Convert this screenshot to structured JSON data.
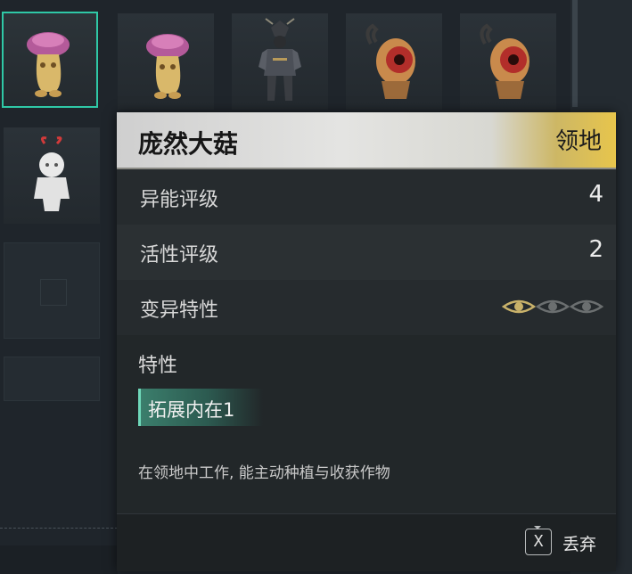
{
  "tooltip": {
    "title": "庞然大菇",
    "tag": "领地",
    "stats": [
      {
        "label": "异能评级",
        "value": "4"
      },
      {
        "label": "活性评级",
        "value": "2"
      }
    ],
    "mutation": {
      "label": "变异特性",
      "level": 1,
      "max": 3
    },
    "traits_heading": "特性",
    "trait_chip": "拓展内在1",
    "description": "在领地中工作, 能主动种植与收获作物",
    "discard": {
      "key": "X",
      "label": "丢弃"
    }
  },
  "inventory": [
    {
      "icon": "mushroom-creature-icon",
      "selected": true
    },
    {
      "icon": "mushroom-creature-icon",
      "selected": false
    },
    {
      "icon": "samurai-armor-icon",
      "selected": false
    },
    {
      "icon": "red-eye-creature-icon",
      "selected": false
    },
    {
      "icon": "red-eye-creature-icon",
      "selected": false
    },
    {
      "icon": "white-doll-icon",
      "selected": false
    },
    {
      "icon": "empty-slot",
      "selected": false
    },
    {
      "icon": "empty-slot",
      "selected": false
    }
  ],
  "colors": {
    "selection": "#2fc8a6",
    "header_accent": "#e7c54c",
    "active_eye": "#c9b26a",
    "inactive_eye": "#6b6f70",
    "trait_chip": "#3b7e6c"
  }
}
